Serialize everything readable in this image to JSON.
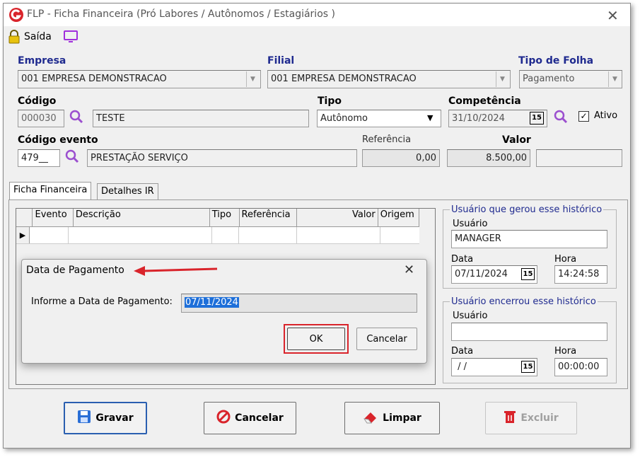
{
  "window": {
    "title": "FLP - Ficha Financeira (Pró Labores / Autônomos / Estagiários )"
  },
  "toolbar": {
    "saida_label": "Saída"
  },
  "empresa": {
    "label": "Empresa",
    "value": "001 EMPRESA DEMONSTRACAO"
  },
  "filial": {
    "label": "Filial",
    "value": "001 EMPRESA DEMONSTRACAO"
  },
  "tipo_folha": {
    "label": "Tipo de Folha",
    "value": "Pagamento"
  },
  "codigo": {
    "label": "Código",
    "value": "000030",
    "name": "TESTE"
  },
  "tipo": {
    "label": "Tipo",
    "value": "Autônomo"
  },
  "competencia": {
    "label": "Competência",
    "value": "31/10/2024",
    "cal": "15"
  },
  "ativo": {
    "label": "Ativo",
    "checked": true
  },
  "evento": {
    "label": "Código evento",
    "code": "479__",
    "desc": "PRESTAÇÃO SERVIÇO"
  },
  "referencia": {
    "label": "Referência",
    "value": "0,00"
  },
  "valor": {
    "label": "Valor",
    "value": "8.500,00"
  },
  "tabs": [
    {
      "label": "Ficha Financeira"
    },
    {
      "label": "Detalhes IR"
    }
  ],
  "grid": {
    "columns": [
      "Evento",
      "Descrição",
      "Tipo",
      "Referência",
      "Valor",
      "Origem"
    ]
  },
  "usuario_gerou": {
    "title": "Usuário que gerou esse histórico",
    "usuario_label": "Usuário",
    "usuario": "MANAGER",
    "data_label": "Data",
    "data": "07/11/2024",
    "hora_label": "Hora",
    "hora": "14:24:58",
    "cal": "15"
  },
  "usuario_encerrou": {
    "title": "Usuário encerrou esse histórico",
    "usuario_label": "Usuário",
    "usuario": "",
    "data_label": "Data",
    "data": " / /",
    "hora_label": "Hora",
    "hora": "00:00:00",
    "cal": "15"
  },
  "buttons": {
    "gravar": "Gravar",
    "cancelar": "Cancelar",
    "limpar": "Limpar",
    "excluir": "Excluir"
  },
  "dialog": {
    "title": "Data de Pagamento",
    "prompt": "Informe a Data de Pagamento:",
    "value": "07/11/2024",
    "ok": "OK",
    "cancel": "Cancelar"
  },
  "colors": {
    "label_blue": "#1f2a8f",
    "accent_red": "#d9242b",
    "search_purple": "#9b4fcf"
  }
}
